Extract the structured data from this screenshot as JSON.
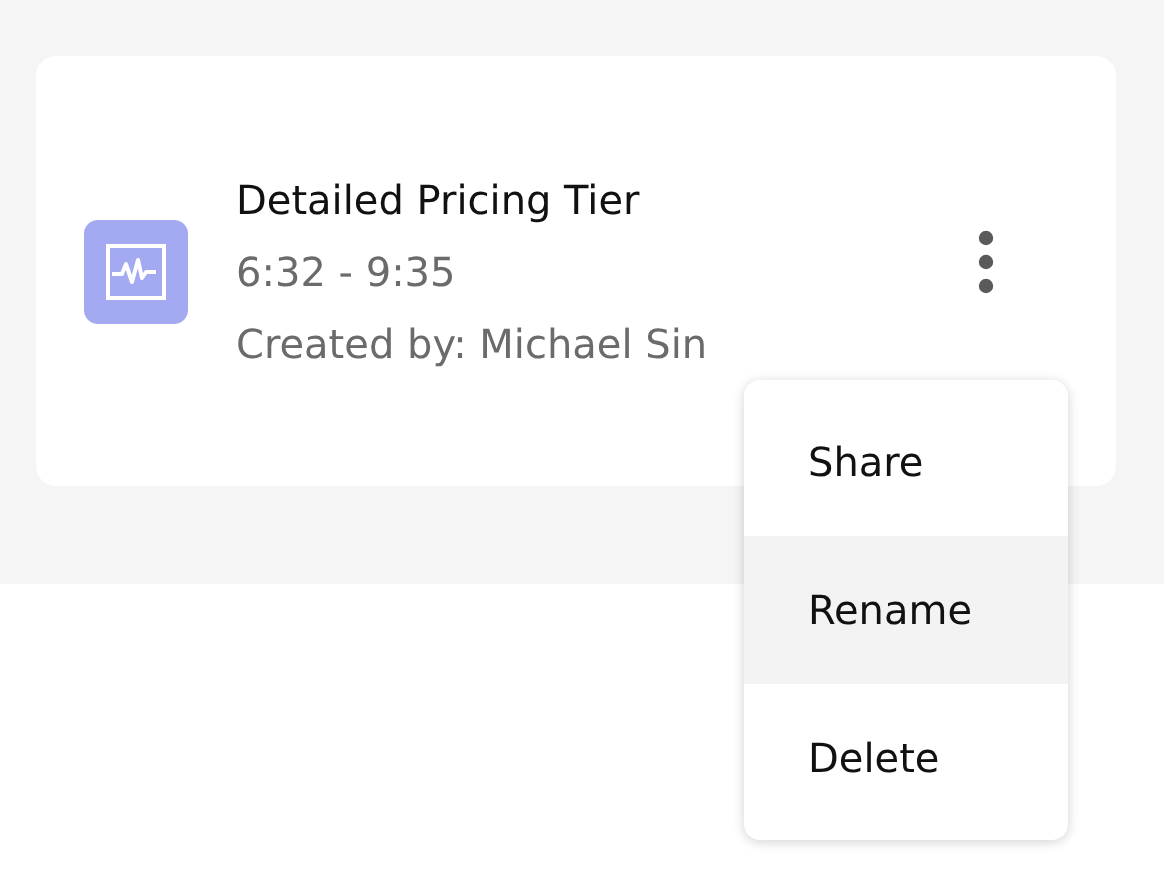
{
  "recording": {
    "title": "Detailed Pricing Tier",
    "time_range": "6:32 - 9:35",
    "created_by": "Created by: Michael Sin"
  },
  "menu": [
    {
      "label": "Share",
      "selected": false
    },
    {
      "label": "Rename",
      "selected": true
    },
    {
      "label": "Delete",
      "selected": false
    }
  ]
}
